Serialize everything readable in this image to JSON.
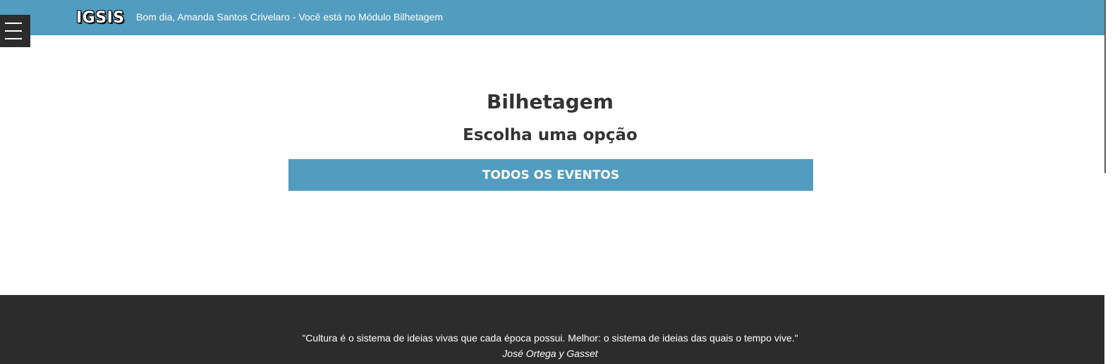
{
  "header": {
    "logo": "IGSIS",
    "greeting": "Bom dia, Amanda Santos Crivelaro - Você está no Módulo Bilhetagem",
    "menu_icon": "hamburger-menu-icon",
    "background_color": "#529cbf"
  },
  "main": {
    "title": "Bilhetagem",
    "subtitle": "Escolha uma opção",
    "button_label": "TODOS OS EVENTOS",
    "button_color": "#529cbf"
  },
  "footer": {
    "quote": "\"Cultura é o sistema de ideias vivas que cada época possui. Melhor: o sistema de ideias das quais o tempo vive.\"",
    "author": "José Ortega y Gasset",
    "background_color": "#2c2c2c"
  }
}
